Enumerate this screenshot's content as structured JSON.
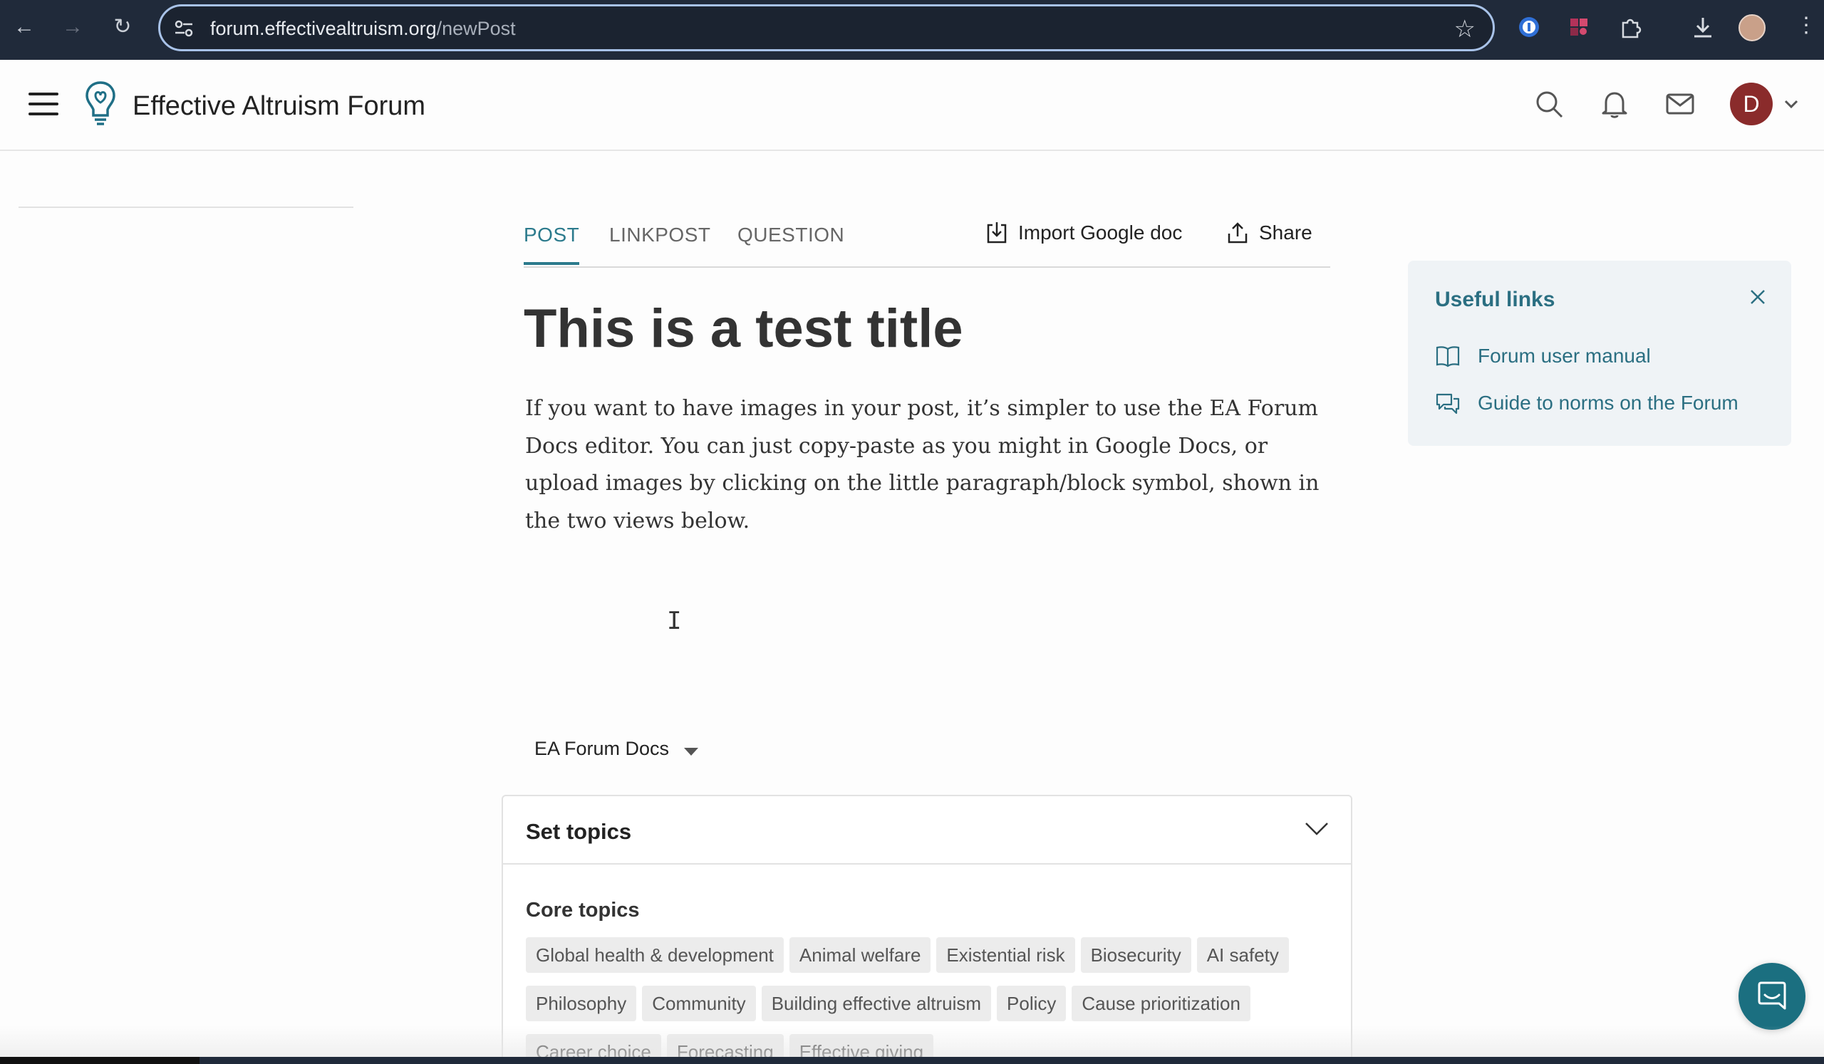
{
  "browser": {
    "url_host": "forum.effectivealtruism.org",
    "url_path": "/newPost"
  },
  "site": {
    "title": "Effective Altruism Forum",
    "avatar_letter": "D"
  },
  "tabs": [
    {
      "label": "POST",
      "active": true
    },
    {
      "label": "LINKPOST",
      "active": false
    },
    {
      "label": "QUESTION",
      "active": false
    }
  ],
  "actions": {
    "import_label": "Import Google doc",
    "share_label": "Share"
  },
  "post": {
    "title": "This is a test title",
    "body": "If you want to have images in your post, it’s simpler to use the EA Forum Docs editor. You can just copy-paste as you might in Google Docs, or upload images by clicking on the little paragraph/block symbol, shown in the two views below."
  },
  "editor": {
    "selected": "EA Forum Docs"
  },
  "topics": {
    "header": "Set topics",
    "core_label": "Core topics",
    "rows": [
      [
        "Global health & development",
        "Animal welfare",
        "Existential risk",
        "Biosecurity",
        "AI safety"
      ],
      [
        "Philosophy",
        "Community",
        "Building effective altruism",
        "Policy",
        "Cause prioritization"
      ],
      [
        "Career choice",
        "Forecasting",
        "Effective giving"
      ]
    ]
  },
  "useful_links": {
    "title": "Useful links",
    "links": [
      {
        "label": "Forum user manual",
        "icon": "book-icon"
      },
      {
        "label": "Guide to norms on the Forum",
        "icon": "chat-bubbles-icon"
      }
    ]
  },
  "colors": {
    "accent": "#2b7a8c",
    "link": "#2b6f82",
    "avatar": "#8a2b2b",
    "chrome": "#202a3a"
  }
}
